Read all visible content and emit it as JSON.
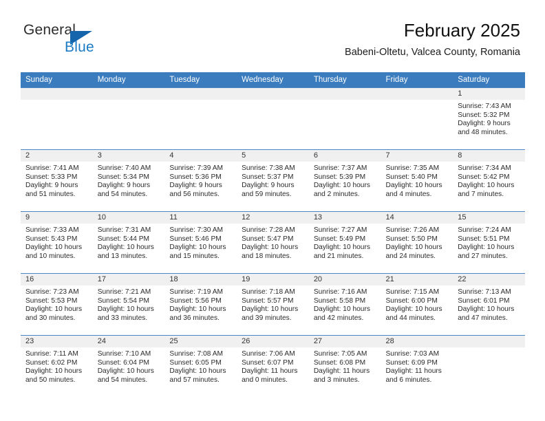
{
  "brand": {
    "name_top": "General",
    "name_bottom": "Blue",
    "accent_color": "#1a7ac4",
    "triangle_color": "#1565ac"
  },
  "header": {
    "title": "February 2025",
    "subtitle": "Babeni-Oltetu, Valcea County, Romania"
  },
  "calendar": {
    "header_bg": "#3a7cbe",
    "daynum_bg": "#f0f0f0",
    "weekday_names": [
      "Sunday",
      "Monday",
      "Tuesday",
      "Wednesday",
      "Thursday",
      "Friday",
      "Saturday"
    ],
    "labels": {
      "sunrise": "Sunrise:",
      "sunset": "Sunset:",
      "daylight": "Daylight:"
    },
    "weeks": [
      [
        {
          "day": "",
          "empty": true
        },
        {
          "day": "",
          "empty": true
        },
        {
          "day": "",
          "empty": true
        },
        {
          "day": "",
          "empty": true
        },
        {
          "day": "",
          "empty": true
        },
        {
          "day": "",
          "empty": true
        },
        {
          "day": "1",
          "sunrise": "Sunrise: 7:43 AM",
          "sunset": "Sunset: 5:32 PM",
          "daylight_1": "Daylight: 9 hours",
          "daylight_2": "and 48 minutes."
        }
      ],
      [
        {
          "day": "2",
          "sunrise": "Sunrise: 7:41 AM",
          "sunset": "Sunset: 5:33 PM",
          "daylight_1": "Daylight: 9 hours",
          "daylight_2": "and 51 minutes."
        },
        {
          "day": "3",
          "sunrise": "Sunrise: 7:40 AM",
          "sunset": "Sunset: 5:34 PM",
          "daylight_1": "Daylight: 9 hours",
          "daylight_2": "and 54 minutes."
        },
        {
          "day": "4",
          "sunrise": "Sunrise: 7:39 AM",
          "sunset": "Sunset: 5:36 PM",
          "daylight_1": "Daylight: 9 hours",
          "daylight_2": "and 56 minutes."
        },
        {
          "day": "5",
          "sunrise": "Sunrise: 7:38 AM",
          "sunset": "Sunset: 5:37 PM",
          "daylight_1": "Daylight: 9 hours",
          "daylight_2": "and 59 minutes."
        },
        {
          "day": "6",
          "sunrise": "Sunrise: 7:37 AM",
          "sunset": "Sunset: 5:39 PM",
          "daylight_1": "Daylight: 10 hours",
          "daylight_2": "and 2 minutes."
        },
        {
          "day": "7",
          "sunrise": "Sunrise: 7:35 AM",
          "sunset": "Sunset: 5:40 PM",
          "daylight_1": "Daylight: 10 hours",
          "daylight_2": "and 4 minutes."
        },
        {
          "day": "8",
          "sunrise": "Sunrise: 7:34 AM",
          "sunset": "Sunset: 5:42 PM",
          "daylight_1": "Daylight: 10 hours",
          "daylight_2": "and 7 minutes."
        }
      ],
      [
        {
          "day": "9",
          "sunrise": "Sunrise: 7:33 AM",
          "sunset": "Sunset: 5:43 PM",
          "daylight_1": "Daylight: 10 hours",
          "daylight_2": "and 10 minutes."
        },
        {
          "day": "10",
          "sunrise": "Sunrise: 7:31 AM",
          "sunset": "Sunset: 5:44 PM",
          "daylight_1": "Daylight: 10 hours",
          "daylight_2": "and 13 minutes."
        },
        {
          "day": "11",
          "sunrise": "Sunrise: 7:30 AM",
          "sunset": "Sunset: 5:46 PM",
          "daylight_1": "Daylight: 10 hours",
          "daylight_2": "and 15 minutes."
        },
        {
          "day": "12",
          "sunrise": "Sunrise: 7:28 AM",
          "sunset": "Sunset: 5:47 PM",
          "daylight_1": "Daylight: 10 hours",
          "daylight_2": "and 18 minutes."
        },
        {
          "day": "13",
          "sunrise": "Sunrise: 7:27 AM",
          "sunset": "Sunset: 5:49 PM",
          "daylight_1": "Daylight: 10 hours",
          "daylight_2": "and 21 minutes."
        },
        {
          "day": "14",
          "sunrise": "Sunrise: 7:26 AM",
          "sunset": "Sunset: 5:50 PM",
          "daylight_1": "Daylight: 10 hours",
          "daylight_2": "and 24 minutes."
        },
        {
          "day": "15",
          "sunrise": "Sunrise: 7:24 AM",
          "sunset": "Sunset: 5:51 PM",
          "daylight_1": "Daylight: 10 hours",
          "daylight_2": "and 27 minutes."
        }
      ],
      [
        {
          "day": "16",
          "sunrise": "Sunrise: 7:23 AM",
          "sunset": "Sunset: 5:53 PM",
          "daylight_1": "Daylight: 10 hours",
          "daylight_2": "and 30 minutes."
        },
        {
          "day": "17",
          "sunrise": "Sunrise: 7:21 AM",
          "sunset": "Sunset: 5:54 PM",
          "daylight_1": "Daylight: 10 hours",
          "daylight_2": "and 33 minutes."
        },
        {
          "day": "18",
          "sunrise": "Sunrise: 7:19 AM",
          "sunset": "Sunset: 5:56 PM",
          "daylight_1": "Daylight: 10 hours",
          "daylight_2": "and 36 minutes."
        },
        {
          "day": "19",
          "sunrise": "Sunrise: 7:18 AM",
          "sunset": "Sunset: 5:57 PM",
          "daylight_1": "Daylight: 10 hours",
          "daylight_2": "and 39 minutes."
        },
        {
          "day": "20",
          "sunrise": "Sunrise: 7:16 AM",
          "sunset": "Sunset: 5:58 PM",
          "daylight_1": "Daylight: 10 hours",
          "daylight_2": "and 42 minutes."
        },
        {
          "day": "21",
          "sunrise": "Sunrise: 7:15 AM",
          "sunset": "Sunset: 6:00 PM",
          "daylight_1": "Daylight: 10 hours",
          "daylight_2": "and 44 minutes."
        },
        {
          "day": "22",
          "sunrise": "Sunrise: 7:13 AM",
          "sunset": "Sunset: 6:01 PM",
          "daylight_1": "Daylight: 10 hours",
          "daylight_2": "and 47 minutes."
        }
      ],
      [
        {
          "day": "23",
          "sunrise": "Sunrise: 7:11 AM",
          "sunset": "Sunset: 6:02 PM",
          "daylight_1": "Daylight: 10 hours",
          "daylight_2": "and 50 minutes."
        },
        {
          "day": "24",
          "sunrise": "Sunrise: 7:10 AM",
          "sunset": "Sunset: 6:04 PM",
          "daylight_1": "Daylight: 10 hours",
          "daylight_2": "and 54 minutes."
        },
        {
          "day": "25",
          "sunrise": "Sunrise: 7:08 AM",
          "sunset": "Sunset: 6:05 PM",
          "daylight_1": "Daylight: 10 hours",
          "daylight_2": "and 57 minutes."
        },
        {
          "day": "26",
          "sunrise": "Sunrise: 7:06 AM",
          "sunset": "Sunset: 6:07 PM",
          "daylight_1": "Daylight: 11 hours",
          "daylight_2": "and 0 minutes."
        },
        {
          "day": "27",
          "sunrise": "Sunrise: 7:05 AM",
          "sunset": "Sunset: 6:08 PM",
          "daylight_1": "Daylight: 11 hours",
          "daylight_2": "and 3 minutes."
        },
        {
          "day": "28",
          "sunrise": "Sunrise: 7:03 AM",
          "sunset": "Sunset: 6:09 PM",
          "daylight_1": "Daylight: 11 hours",
          "daylight_2": "and 6 minutes."
        },
        {
          "day": "",
          "empty": true
        }
      ]
    ]
  }
}
